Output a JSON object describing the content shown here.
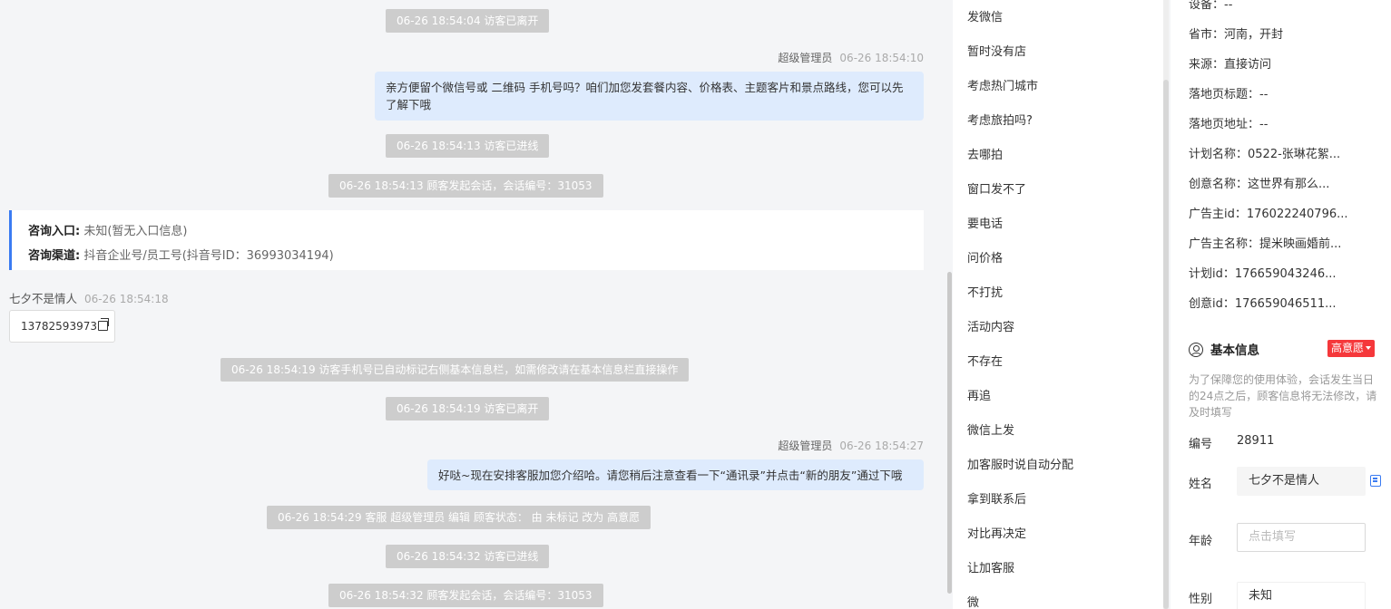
{
  "chat": {
    "sys_messages": [
      "06-26 18:54:04 访客已离开",
      "06-26 18:54:13 访客已进线",
      "06-26 18:54:13 顾客发起会话，会话编号：31053",
      "06-26 18:54:19 访客手机号已自动标记右侧基本信息栏，如需修改请在基本信息栏直接操作",
      "06-26 18:54:19 访客已离开",
      "06-26 18:54:29 客服 超级管理员 编辑 顾客状态： 由 未标记 改为 高意愿",
      "06-26 18:54:32 访客已进线",
      "06-26 18:54:32 顾客发起会话，会话编号：31053"
    ],
    "agent_messages": [
      {
        "sender": "超级管理员",
        "time": "06-26 18:54:10",
        "text": "亲方便留个微信号或 二维码 手机号吗？咱们加您发套餐内容、价格表、主题客片和景点路线，您可以先了解下哦"
      },
      {
        "sender": "超级管理员",
        "time": "06-26 18:54:27",
        "text": "好哒~现在安排客服加您介绍哈。请您稍后注意查看一下“通讯录”并点击“新的朋友”通过下哦"
      }
    ],
    "info_card": {
      "entry_label": "咨询入口:",
      "entry_value": "未知(暂无入口信息)",
      "channel_label": "咨询渠道:",
      "channel_value": "抖音企业号/员工号(抖音号ID：36993034194)"
    },
    "visitor": {
      "name": "七夕不是情人",
      "time": "06-26 18:54:18",
      "phone": "13782593973"
    }
  },
  "quick_replies": [
    "发微信",
    "暂时没有店",
    "考虑热门城市",
    "考虑旅拍吗?",
    "去哪拍",
    "窗口发不了",
    "要电话",
    "问价格",
    "不打扰",
    "活动内容",
    "不存在",
    "再追",
    "微信上发",
    "加客服时说自动分配",
    "拿到联系后",
    "对比再决定",
    "让加客服",
    "微"
  ],
  "info_panel": {
    "top_partial": "设备：--",
    "rows": [
      "省市：河南，开封",
      "来源：直接访问",
      "落地页标题：--",
      "落地页地址：--",
      "计划名称：0522-张琳花絮...",
      "创意名称：这世界有那么...",
      "广告主id：176022240796...",
      "广告主名称：提米映画婚前...",
      "计划id：176659043246...",
      "创意id：176659046511..."
    ],
    "basic_title": "基本信息",
    "intent_badge": "高意愿",
    "notice": "为了保障您的使用体验，会话发生当日的24点之后，顾客信息将无法修改，请及时填写",
    "number_label": "编号",
    "number_value": "28911",
    "name_label": "姓名",
    "name_value": "七夕不是情人",
    "age_label": "年龄",
    "age_placeholder": "点击填写",
    "gender_label": "性别",
    "gender_value": "未知"
  },
  "colors": {
    "accent": "#3a7bf2",
    "agent_bubble": "#deebfd",
    "system_pill": "#cdcdcd",
    "badge_red": "#f5383b"
  }
}
